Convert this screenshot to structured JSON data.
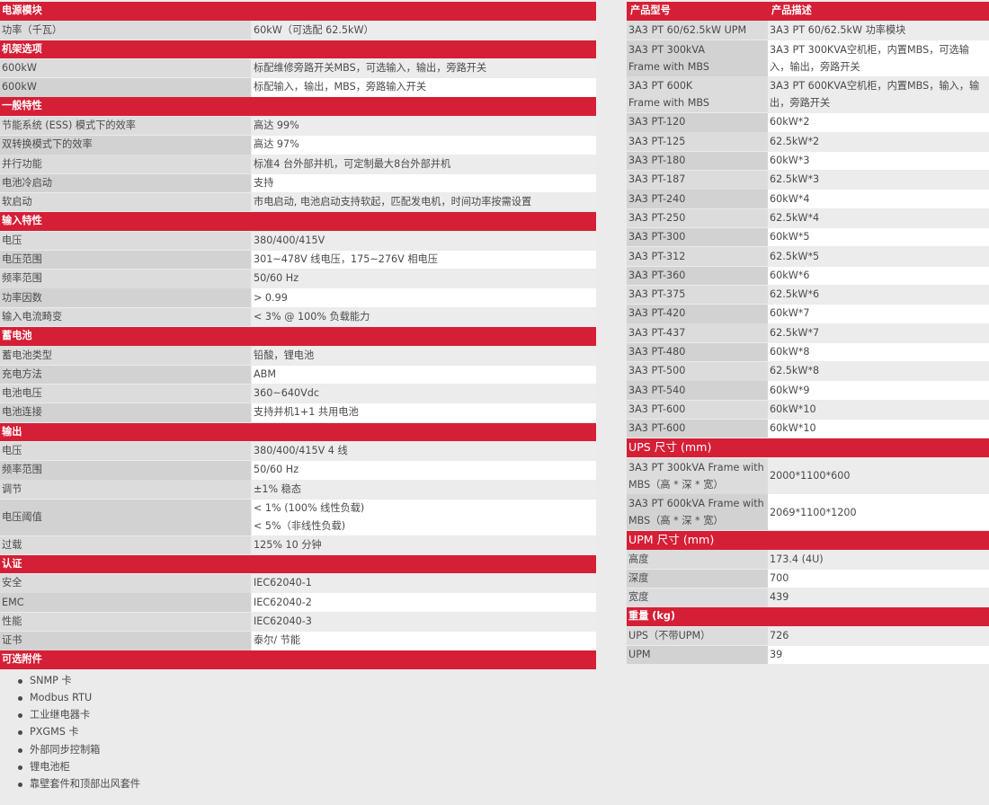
{
  "left": [
    {
      "header": "电源模块",
      "rows": [
        [
          "功率（千瓦）",
          "60kW（可选配 62.5kW）"
        ]
      ]
    },
    {
      "header": "机架选项",
      "rows": [
        [
          "600kW",
          "标配维修旁路开关MBS，可选输入，输出，旁路开关"
        ],
        [
          "600kW",
          "标配输入，输出，MBS，旁路输入开关"
        ]
      ]
    },
    {
      "header": "一般特性",
      "rows": [
        [
          "节能系统 (ESS) 模式下的效率",
          "高达 99%"
        ],
        [
          "双转换模式下的效率",
          "高达 97%"
        ],
        [
          "并行功能",
          "标准4 台外部并机，可定制最大8台外部并机"
        ],
        [
          "电池冷启动",
          "支持"
        ],
        [
          "软启动",
          "市电启动, 电池启动支持软起，匹配发电机，时间功率按需设置"
        ]
      ]
    },
    {
      "header": "输入特性",
      "rows": [
        [
          "电压",
          "380/400/415V"
        ],
        [
          "电压范围",
          "301~478V 线电压，175~276V 相电压"
        ],
        [
          "频率范围",
          "50/60 Hz"
        ],
        [
          "功率因数",
          "> 0.99"
        ],
        [
          "输入电流畸变",
          "< 3% @ 100% 负载能力"
        ]
      ]
    },
    {
      "header": "蓄电池",
      "rows": [
        [
          "蓄电池类型",
          "铅酸，锂电池"
        ],
        [
          "充电方法",
          "ABM"
        ],
        [
          "电池电压",
          "360~640Vdc"
        ],
        [
          "电池连接",
          "支持并机1+1 共用电池"
        ]
      ]
    },
    {
      "header": "输出",
      "rows": [
        [
          "电压",
          "380/400/415V  4 线"
        ],
        [
          "频率范围",
          "50/60 Hz"
        ],
        [
          "调节",
          "±1% 稳态"
        ],
        [
          "电压阈值",
          "< 1% (100% 线性负载)\n< 5%（非线性负载)"
        ],
        [
          "过载",
          "125% 10 分钟"
        ]
      ]
    },
    {
      "header": "认证",
      "rows": [
        [
          "安全",
          "IEC62040-1"
        ],
        [
          "EMC",
          "IEC62040-2"
        ],
        [
          "性能",
          "IEC62040-3"
        ],
        [
          "证书",
          "泰尔/ 节能"
        ]
      ]
    },
    {
      "header": "可选附件",
      "rows": []
    }
  ],
  "accessories": [
    "SNMP 卡",
    "Modbus RTU",
    "工业继电器卡",
    "PXGMS 卡",
    "外部同步控制箱",
    "锂电池柜",
    "靠壁套件和顶部出风套件"
  ],
  "right": {
    "header_model": "产品型号",
    "header_desc": "产品描述",
    "products": [
      [
        "3A3 PT 60/62.5kW UPM",
        "3A3 PT 60/62.5kW 功率模块"
      ],
      [
        "3A3 PT 300kVA\nFrame with MBS",
        "3A3 PT 300KVA空机柜，内置MBS，可选输\n入，输出，旁路开关"
      ],
      [
        "3A3 PT 600K\nFrame with MBS",
        "3A3 PT 600KVA空机柜，内置MBS，输入，输\n出，旁路开关"
      ],
      [
        "3A3 PT-120",
        "60kW*2"
      ],
      [
        "3A3 PT-125",
        "62.5kW*2"
      ],
      [
        "3A3 PT-180",
        "60kW*3"
      ],
      [
        "3A3 PT-187",
        "62.5kW*3"
      ],
      [
        "3A3 PT-240",
        "60kW*4"
      ],
      [
        "3A3 PT-250",
        "62.5kW*4"
      ],
      [
        "3A3 PT-300",
        "60kW*5"
      ],
      [
        "3A3 PT-312",
        "62.5kW*5"
      ],
      [
        "3A3 PT-360",
        "60kW*6"
      ],
      [
        "3A3 PT-375",
        "62.5kW*6"
      ],
      [
        "3A3 PT-420",
        "60kW*7"
      ],
      [
        "3A3 PT-437",
        "62.5kW*7"
      ],
      [
        "3A3 PT-480",
        "60kW*8"
      ],
      [
        "3A3 PT-500",
        "62.5kW*8"
      ],
      [
        "3A3 PT-540",
        "60kW*9"
      ],
      [
        "3A3 PT-600",
        "60kW*10"
      ],
      [
        "3A3 PT-600",
        "60kW*10"
      ]
    ],
    "ups_size": {
      "header": "UPS 尺寸 (mm)",
      "rows": [
        [
          "3A3 PT 300kVA Frame with\nMBS（高 * 深 * 宽）",
          "2000*1100*600"
        ],
        [
          "3A3 PT 600kVA Frame with\nMBS（高 * 深 * 宽）",
          "2069*1100*1200"
        ]
      ]
    },
    "upm_size": {
      "header": "UPM 尺寸 (mm)",
      "rows": [
        [
          "高度",
          "173.4 (4U)"
        ],
        [
          "深度",
          "700"
        ],
        [
          "宽度",
          "439"
        ]
      ]
    },
    "weight": {
      "header": "重量 (kg)",
      "rows": [
        [
          "UPS（不带UPM）",
          "726"
        ],
        [
          "UPM",
          "39"
        ]
      ]
    }
  }
}
